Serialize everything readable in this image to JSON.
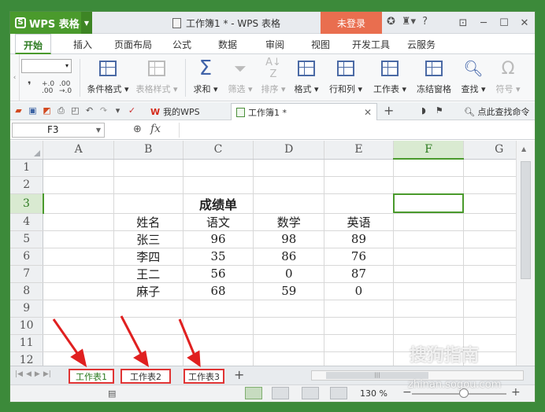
{
  "titlebar": {
    "app_button": "WPS 表格",
    "doc_title": "工作簿1 * - WPS 表格",
    "login": "未登录",
    "help": "?"
  },
  "menu": {
    "tabs": [
      "开始",
      "插入",
      "页面布局",
      "公式",
      "数据",
      "审阅",
      "视图",
      "开发工具",
      "云服务"
    ]
  },
  "ribbon": {
    "font_size_combo": "",
    "inc_dec": ".00",
    "groups": [
      {
        "label": "条件格式 ▾",
        "icon": "conditional-format-icon"
      },
      {
        "label": "表格样式 ▾",
        "icon": "table-style-icon"
      },
      {
        "label": "求和 ▾",
        "icon": "sigma-icon"
      },
      {
        "label": "筛选 ▾",
        "icon": "filter-icon"
      },
      {
        "label": "排序 ▾",
        "icon": "sort-icon"
      },
      {
        "label": "格式 ▾",
        "icon": "format-icon"
      },
      {
        "label": "行和列 ▾",
        "icon": "row-col-icon"
      },
      {
        "label": "工作表 ▾",
        "icon": "worksheet-icon"
      },
      {
        "label": "冻结窗格",
        "icon": "freeze-panes-icon"
      },
      {
        "label": "查找 ▾",
        "icon": "find-icon"
      },
      {
        "label": "符号 ▾",
        "icon": "symbol-icon"
      }
    ]
  },
  "doc_tabs": {
    "mywps": "我的WPS",
    "current": "工作簿1 *",
    "search": "点此查找命令"
  },
  "formula_bar": {
    "name_box": "F3",
    "fx": "fx"
  },
  "sheet": {
    "columns": [
      "A",
      "B",
      "C",
      "D",
      "E",
      "F",
      "G"
    ],
    "rows": [
      "1",
      "2",
      "3",
      "4",
      "5",
      "6",
      "7",
      "8",
      "9",
      "10",
      "11",
      "12"
    ],
    "title": "成绩单",
    "headers": [
      "姓名",
      "语文",
      "数学",
      "英语"
    ],
    "records": [
      [
        "张三",
        "96",
        "98",
        "89"
      ],
      [
        "李四",
        "35",
        "86",
        "76"
      ],
      [
        "王二",
        "56",
        "0",
        "87"
      ],
      [
        "麻子",
        "68",
        "59",
        "0"
      ]
    ],
    "active_cell": "F3"
  },
  "sheet_tabs": [
    "工作表1",
    "工作表2",
    "工作表3"
  ],
  "status": {
    "zoom": "130 %"
  },
  "watermark": {
    "text": "搜狗指南",
    "url": "zhinan.sogou.com"
  }
}
